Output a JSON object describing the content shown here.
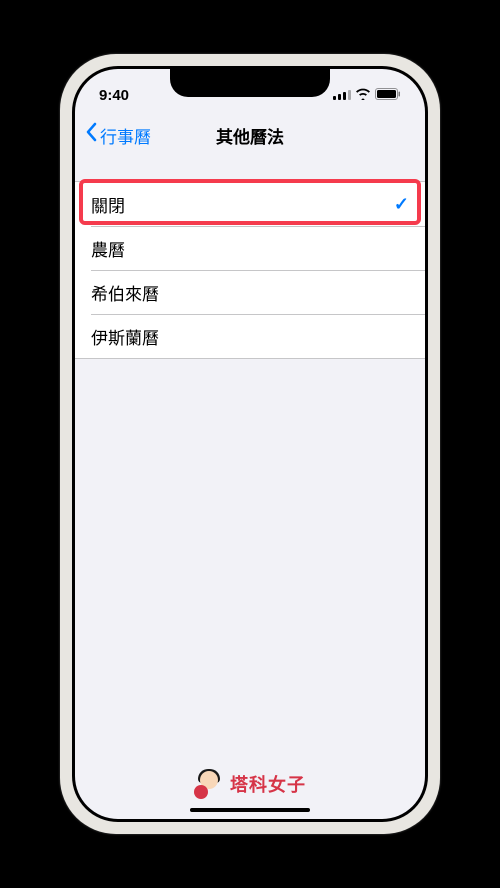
{
  "statusBar": {
    "time": "9:40"
  },
  "navBar": {
    "backLabel": "行事曆",
    "title": "其他曆法"
  },
  "options": [
    {
      "label": "關閉",
      "selected": true
    },
    {
      "label": "農曆",
      "selected": false
    },
    {
      "label": "希伯來曆",
      "selected": false
    },
    {
      "label": "伊斯蘭曆",
      "selected": false
    }
  ],
  "checkmarkGlyph": "✓",
  "watermark": {
    "text": "塔科女子"
  },
  "colors": {
    "accent": "#007aff",
    "highlight": "#f53b4d",
    "background": "#f2f2f7",
    "watermarkText": "#d63447"
  }
}
